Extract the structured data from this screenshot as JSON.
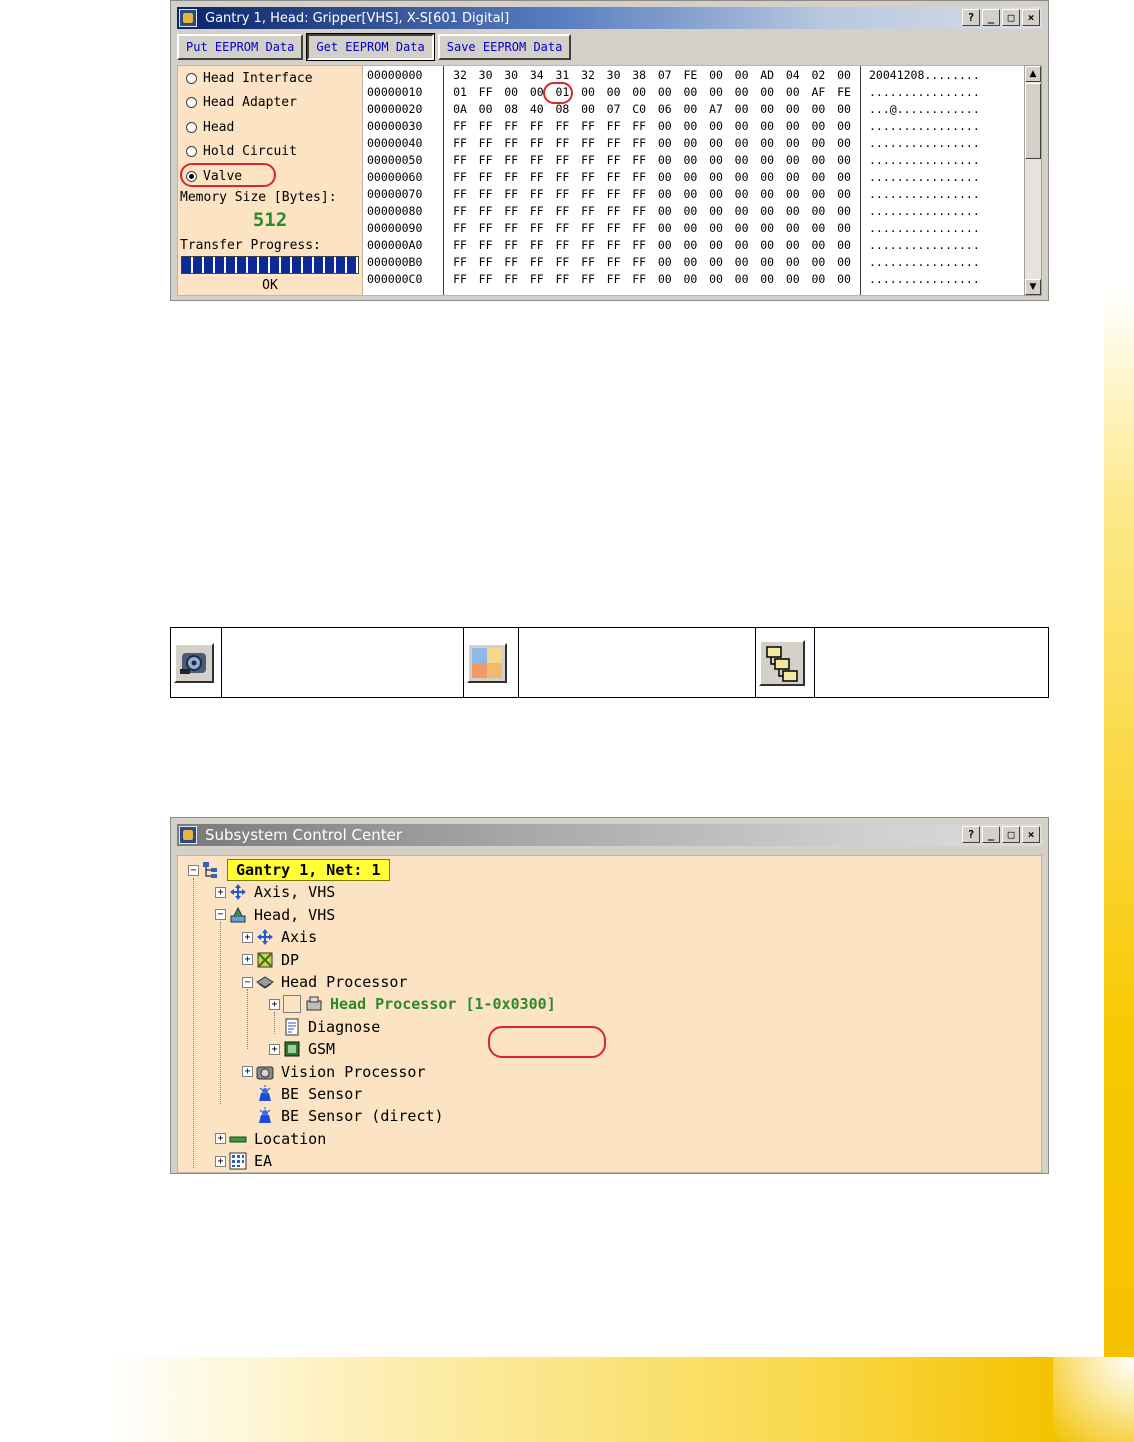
{
  "eeprom_window": {
    "title": "Gantry 1, Head: Gripper[VHS], X-S[601 Digital]",
    "buttons": [
      "Put EEPROM Data",
      "Get EEPROM Data",
      "Save EEPROM Data"
    ],
    "active_button_index": 1,
    "radio_options": [
      "Head Interface",
      "Head Adapter",
      "Head",
      "Hold Circuit",
      "Valve"
    ],
    "selected_radio_index": 4,
    "memory_size_label": "Memory Size [Bytes]:",
    "memory_size_value": "512",
    "transfer_progress_label": "Transfer Progress:",
    "transfer_progress_fraction": 1.0,
    "status_text": "OK",
    "hex_rows": [
      {
        "addr": "00000000",
        "bytes": [
          "32",
          "30",
          "30",
          "34",
          "31",
          "32",
          "30",
          "38",
          "07",
          "FE",
          "00",
          "00",
          "AD",
          "04",
          "02",
          "00"
        ],
        "ascii": "20041208........"
      },
      {
        "addr": "00000010",
        "bytes": [
          "01",
          "FF",
          "00",
          "00",
          "01",
          "00",
          "00",
          "00",
          "00",
          "00",
          "00",
          "00",
          "00",
          "00",
          "AF",
          "FE"
        ],
        "ascii": "................"
      },
      {
        "addr": "00000020",
        "bytes": [
          "0A",
          "00",
          "08",
          "40",
          "08",
          "00",
          "07",
          "C0",
          "06",
          "00",
          "A7",
          "00",
          "00",
          "00",
          "00",
          "00"
        ],
        "ascii": "...@............"
      },
      {
        "addr": "00000030",
        "bytes": [
          "FF",
          "FF",
          "FF",
          "FF",
          "FF",
          "FF",
          "FF",
          "FF",
          "00",
          "00",
          "00",
          "00",
          "00",
          "00",
          "00",
          "00"
        ],
        "ascii": "................"
      },
      {
        "addr": "00000040",
        "bytes": [
          "FF",
          "FF",
          "FF",
          "FF",
          "FF",
          "FF",
          "FF",
          "FF",
          "00",
          "00",
          "00",
          "00",
          "00",
          "00",
          "00",
          "00"
        ],
        "ascii": "................"
      },
      {
        "addr": "00000050",
        "bytes": [
          "FF",
          "FF",
          "FF",
          "FF",
          "FF",
          "FF",
          "FF",
          "FF",
          "00",
          "00",
          "00",
          "00",
          "00",
          "00",
          "00",
          "00"
        ],
        "ascii": "................"
      },
      {
        "addr": "00000060",
        "bytes": [
          "FF",
          "FF",
          "FF",
          "FF",
          "FF",
          "FF",
          "FF",
          "FF",
          "00",
          "00",
          "00",
          "00",
          "00",
          "00",
          "00",
          "00"
        ],
        "ascii": "................"
      },
      {
        "addr": "00000070",
        "bytes": [
          "FF",
          "FF",
          "FF",
          "FF",
          "FF",
          "FF",
          "FF",
          "FF",
          "00",
          "00",
          "00",
          "00",
          "00",
          "00",
          "00",
          "00"
        ],
        "ascii": "................"
      },
      {
        "addr": "00000080",
        "bytes": [
          "FF",
          "FF",
          "FF",
          "FF",
          "FF",
          "FF",
          "FF",
          "FF",
          "00",
          "00",
          "00",
          "00",
          "00",
          "00",
          "00",
          "00"
        ],
        "ascii": "................"
      },
      {
        "addr": "00000090",
        "bytes": [
          "FF",
          "FF",
          "FF",
          "FF",
          "FF",
          "FF",
          "FF",
          "FF",
          "00",
          "00",
          "00",
          "00",
          "00",
          "00",
          "00",
          "00"
        ],
        "ascii": "................"
      },
      {
        "addr": "000000A0",
        "bytes": [
          "FF",
          "FF",
          "FF",
          "FF",
          "FF",
          "FF",
          "FF",
          "FF",
          "00",
          "00",
          "00",
          "00",
          "00",
          "00",
          "00",
          "00"
        ],
        "ascii": "................"
      },
      {
        "addr": "000000B0",
        "bytes": [
          "FF",
          "FF",
          "FF",
          "FF",
          "FF",
          "FF",
          "FF",
          "FF",
          "00",
          "00",
          "00",
          "00",
          "00",
          "00",
          "00",
          "00"
        ],
        "ascii": "................"
      },
      {
        "addr": "000000C0",
        "bytes": [
          "FF",
          "FF",
          "FF",
          "FF",
          "FF",
          "FF",
          "FF",
          "FF",
          "00",
          "00",
          "00",
          "00",
          "00",
          "00",
          "00",
          "00"
        ],
        "ascii": "................"
      }
    ],
    "highlight_color": "#d9262c"
  },
  "icon_table": {
    "icons": [
      "gripper-head-icon",
      "color-palette-icon",
      "hierarchy-tree-icon"
    ]
  },
  "subsystem_window": {
    "title": "Subsystem Control Center",
    "tree": [
      {
        "label": "Gantry 1, Net: 1",
        "icon": "network-tree-icon",
        "expander": "minus",
        "style": "highlight"
      },
      {
        "label": "Axis, VHS",
        "icon": "axis-arrows-icon",
        "expander": "plus"
      },
      {
        "label": "Head, VHS",
        "icon": "head-icon",
        "expander": "minus"
      },
      {
        "label": "Axis",
        "icon": "axis-arrows-icon",
        "expander": "plus"
      },
      {
        "label": "DP",
        "icon": "dp-icon",
        "expander": "plus"
      },
      {
        "label": "Head Processor",
        "icon": "chip-icon",
        "expander": "minus"
      },
      {
        "label": "Head Processor",
        "suffix": "[1-0x0300]",
        "icon": "processor-icon",
        "expander": "plus",
        "style": "green"
      },
      {
        "label": "Diagnose",
        "icon": "diagnose-icon",
        "expander": "none"
      },
      {
        "label": "GSM",
        "icon": "gsm-icon",
        "expander": "plus"
      },
      {
        "label": "Vision Processor",
        "icon": "camera-icon",
        "expander": "plus"
      },
      {
        "label": "BE Sensor",
        "icon": "sensor-icon",
        "expander": "none"
      },
      {
        "label": "BE Sensor (direct)",
        "icon": "sensor-icon",
        "expander": "none"
      },
      {
        "label": "Location",
        "icon": "location-bar-icon",
        "expander": "plus"
      },
      {
        "label": "EA",
        "icon": "ea-grid-icon",
        "expander": "plus"
      }
    ]
  }
}
